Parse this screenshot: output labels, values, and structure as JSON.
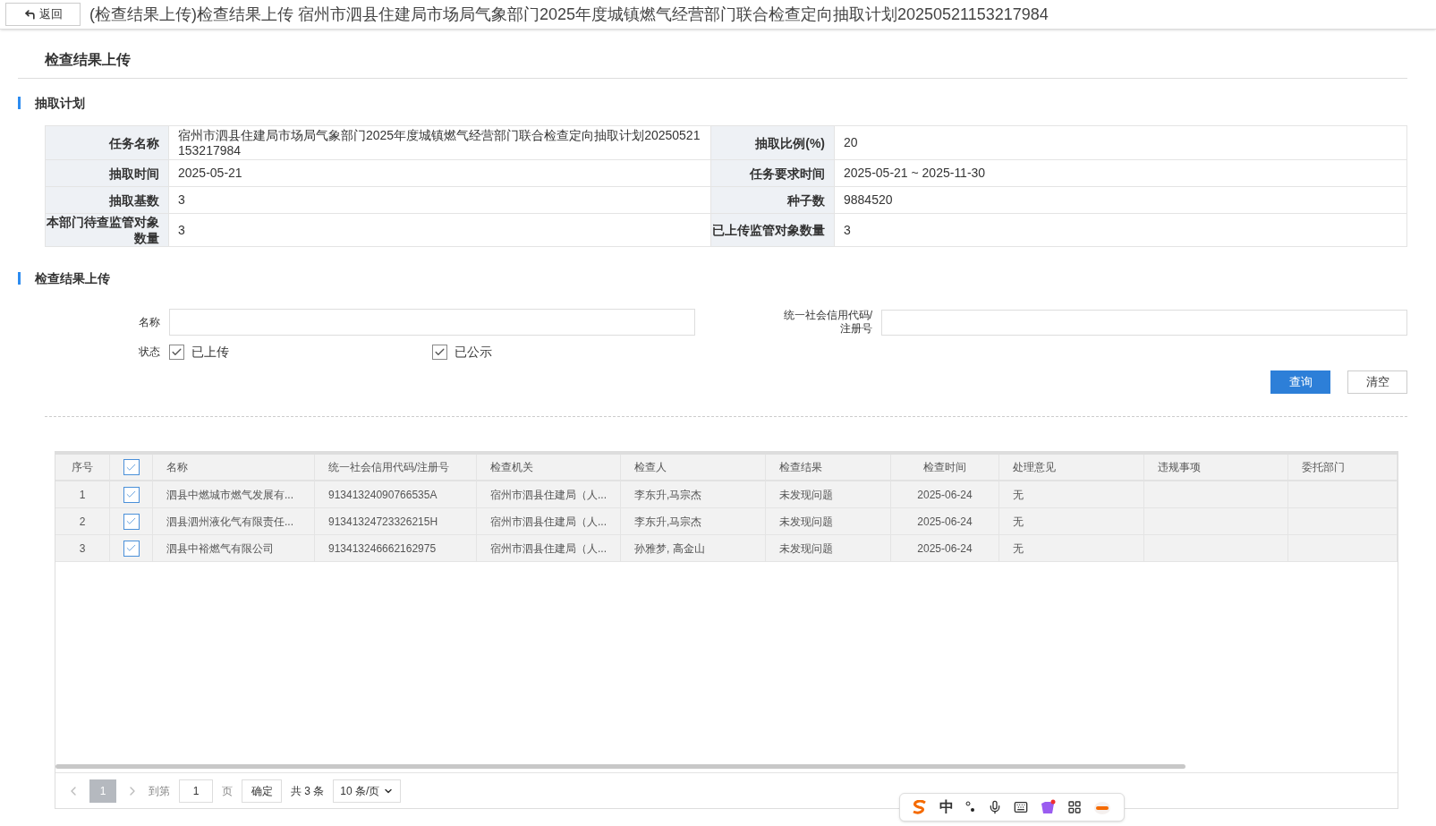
{
  "top_bar": {
    "back_label": "返回",
    "title": "(检查结果上传)检查结果上传 宿州市泗县住建局市场局气象部门2025年度城镇燃气经营部门联合检查定向抽取计划20250521153217984"
  },
  "page_title": "检查结果上传",
  "plan_section": {
    "title": "抽取计划",
    "rows": [
      [
        {
          "label": "任务名称",
          "value": "宿州市泗县住建局市场局气象部门2025年度城镇燃气经营部门联合检查定向抽取计划20250521153217984"
        },
        {
          "label": "抽取比例(%)",
          "value": "20"
        }
      ],
      [
        {
          "label": "抽取时间",
          "value": "2025-05-21"
        },
        {
          "label": "任务要求时间",
          "value": "2025-05-21 ~ 2025-11-30"
        }
      ],
      [
        {
          "label": "抽取基数",
          "value": "3"
        },
        {
          "label": "种子数",
          "value": "9884520"
        }
      ],
      [
        {
          "label": "本部门待查监管对象数量",
          "value": "3"
        },
        {
          "label": "已上传监管对象数量",
          "value": "3"
        }
      ]
    ]
  },
  "upload_section": {
    "title": "检查结果上传",
    "filters": {
      "name_label": "名称",
      "code_label": "统一社会信用代码/注册号",
      "status_label": "状态",
      "status_options": [
        {
          "label": "已上传",
          "checked": true
        },
        {
          "label": "已公示",
          "checked": true
        }
      ],
      "buttons": [
        {
          "label": "查询",
          "kind": "primary"
        },
        {
          "label": "清空",
          "kind": "default"
        }
      ]
    },
    "table": {
      "columns": [
        "序号",
        "",
        "名称",
        "统一社会信用代码/注册号",
        "检查机关",
        "检查人",
        "检查结果",
        "检查时间",
        "处理意见",
        "违规事项",
        "委托部门"
      ],
      "all_checked": true,
      "rows": [
        {
          "cells": [
            "1",
            "",
            "泗县中燃城市燃气发展有...",
            "91341324090766535A",
            "宿州市泗县住建局（人...",
            "李东升,马宗杰",
            "未发现问题",
            "2025-06-24",
            "无",
            "",
            ""
          ],
          "checked": true
        },
        {
          "cells": [
            "2",
            "",
            "泗县泗州液化气有限责任...",
            "91341324723326215H",
            "宿州市泗县住建局（人...",
            "李东升,马宗杰",
            "未发现问题",
            "2025-06-24",
            "无",
            "",
            ""
          ],
          "checked": true
        },
        {
          "cells": [
            "3",
            "",
            "泗县中裕燃气有限公司",
            "913413246662162975",
            "宿州市泗县住建局（人...",
            "孙雅梦, 高金山",
            "未发现问题",
            "2025-06-24",
            "无",
            "",
            ""
          ],
          "checked": true
        }
      ]
    },
    "pager": {
      "current_page": "1",
      "goto_label": "到第",
      "goto_value": "1",
      "page_unit": "页",
      "confirm": "确定",
      "total": "共 3 条",
      "page_size": "10 条/页"
    }
  },
  "ime_toolbar": {
    "mode": "中"
  }
}
